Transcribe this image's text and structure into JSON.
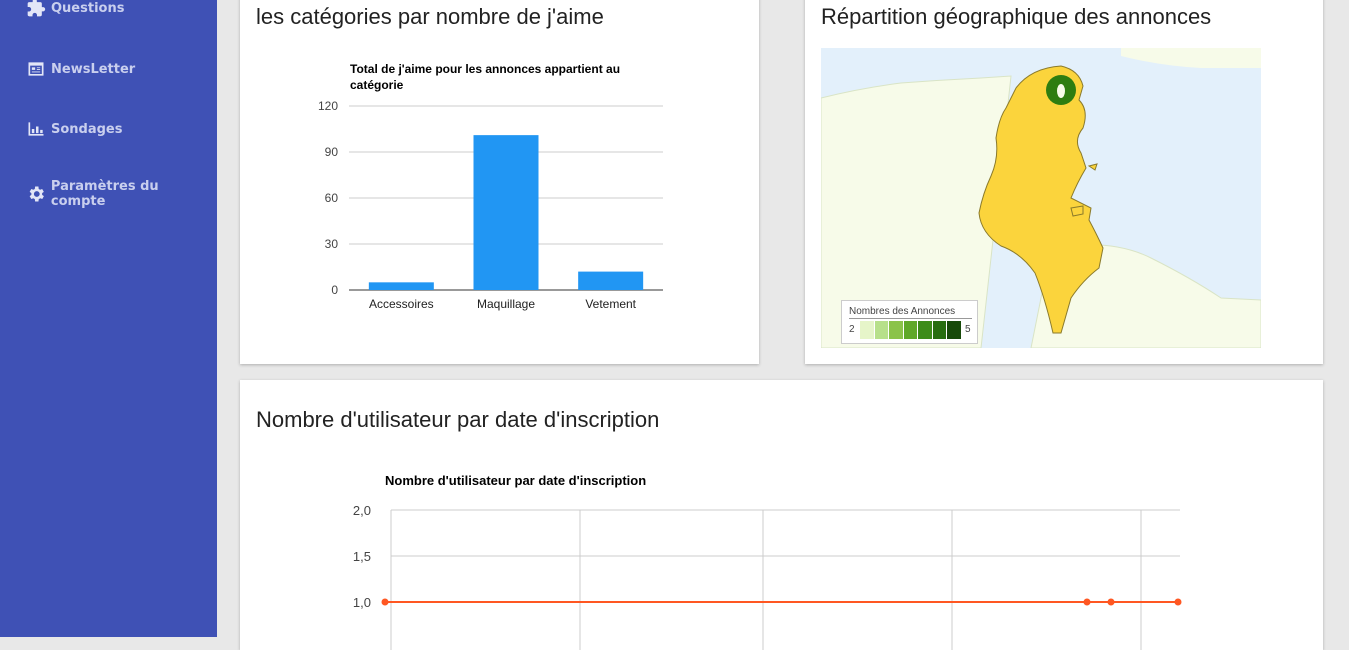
{
  "sidebar": {
    "items": [
      {
        "label": "Questions",
        "icon": "puzzle-icon"
      },
      {
        "label": "NewsLetter",
        "icon": "newspaper-icon"
      },
      {
        "label": "Sondages",
        "icon": "bar-chart-icon"
      },
      {
        "label": "Paramètres du compte",
        "icon": "gear-icon"
      }
    ]
  },
  "likes_card": {
    "title": "les catégories par nombre de j'aime",
    "chart_title_line1": "Total de j'aime pour les annonces appartient au",
    "chart_title_line2": "catégorie"
  },
  "geo_card": {
    "title": "Répartition géographique des annonces",
    "legend_title": "Nombres des Annonces",
    "legend_min": "2",
    "legend_max": "5"
  },
  "users_card": {
    "title": "Nombre d'utilisateur par date d'inscription",
    "chart_title": "Nombre d'utilisateur par date d'inscription"
  },
  "colors": {
    "sidebar": "#3f51b5",
    "bar": "#2196f3",
    "line": "#ff5722",
    "tunisia": "#fbd43c",
    "sea": "#e3f0fb",
    "land": "#f7fbe9",
    "marker": "#2e7d10"
  },
  "chart_data": [
    {
      "type": "bar",
      "title": "Total de j'aime pour les annonces appartient au catégorie",
      "categories": [
        "Accessoires",
        "Maquillage",
        "Vetement"
      ],
      "values": [
        5,
        101,
        12
      ],
      "ylim": [
        0,
        120
      ],
      "yticks": [
        0,
        30,
        60,
        90,
        120
      ],
      "ytick_labels": [
        "0",
        "30",
        "60",
        "90",
        "120"
      ],
      "grid": true
    },
    {
      "type": "line",
      "title": "Nombre d'utilisateur par date d'inscription",
      "y_visible_range": [
        1.0,
        2.0
      ],
      "yticks": [
        1.0,
        1.5,
        2.0
      ],
      "ytick_labels": [
        "1,0",
        "1,5",
        "2,0"
      ],
      "values": [
        1,
        1,
        1,
        1
      ],
      "grid": true
    }
  ]
}
